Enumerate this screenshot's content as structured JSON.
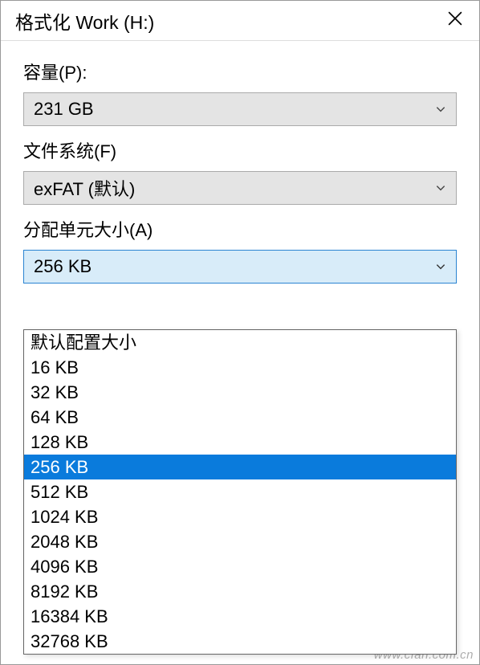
{
  "window": {
    "title": "格式化 Work (H:)"
  },
  "capacity": {
    "label": "容量(P):",
    "value": "231 GB"
  },
  "filesystem": {
    "label": "文件系统(F)",
    "value": "exFAT (默认)"
  },
  "allocation": {
    "label": "分配单元大小(A)",
    "value": "256 KB",
    "options": [
      "默认配置大小",
      "16 KB",
      "32 KB",
      "64 KB",
      "128 KB",
      "256 KB",
      "512 KB",
      "1024 KB",
      "2048 KB",
      "4096 KB",
      "8192 KB",
      "16384 KB",
      "32768 KB"
    ],
    "selected_index": 5
  },
  "watermark": "www.cfan.com.cn"
}
